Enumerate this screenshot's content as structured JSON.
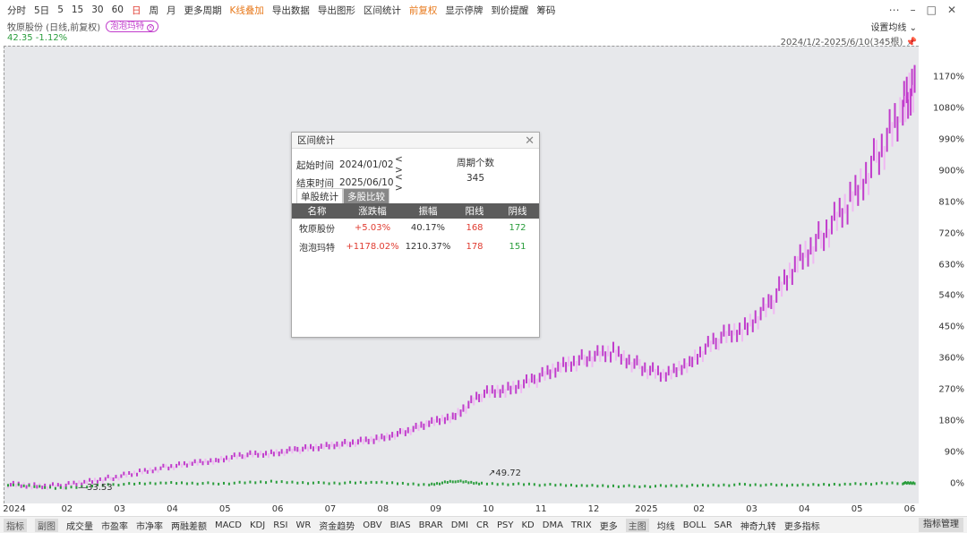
{
  "toolbar": {
    "items": [
      "分时",
      "5日",
      "5",
      "15",
      "30",
      "60",
      "日",
      "周",
      "月",
      "更多周期",
      "K线叠加",
      "导出数据",
      "导出图形",
      "区间统计",
      "前复权",
      "显示停牌",
      "到价提醒",
      "筹码"
    ],
    "active_item": "日",
    "right_icons": [
      "more-icon",
      "minimize-icon",
      "maximize-icon",
      "close-icon"
    ]
  },
  "subhead": {
    "stock_name": "牧原股份 (日线,前复权)",
    "overlay_badge": "泡泡玛特",
    "price_change": "42.35 -1.12%",
    "settings_avg": "设置均线",
    "range_text": "2024/1/2-2025/6/10(345根)"
  },
  "dialog": {
    "title": "区间统计",
    "start_label": "起始时间",
    "start_value": "2024/01/02",
    "end_label": "结束时间",
    "end_value": "2025/06/10",
    "arrows": "< >",
    "period_label": "周期个数",
    "period_value": "345",
    "tab_single": "单股统计",
    "tab_multi": "多股比较",
    "columns": [
      "名称",
      "涨跌幅",
      "振幅",
      "阳线",
      "阴线"
    ],
    "rows": [
      {
        "name": "牧原股份",
        "change": "+5.03%",
        "amplitude": "40.17%",
        "up": "168",
        "down": "172"
      },
      {
        "name": "泡泡玛特",
        "change": "+1178.02%",
        "amplitude": "1210.37%",
        "up": "178",
        "down": "151"
      }
    ]
  },
  "chart_data": {
    "type": "line",
    "y_ticks": [
      "1170%",
      "1080%",
      "990%",
      "900%",
      "810%",
      "720%",
      "630%",
      "540%",
      "450%",
      "360%",
      "270%",
      "180%",
      "90%",
      "0%"
    ],
    "x_ticks": [
      "2024",
      "02",
      "03",
      "04",
      "05",
      "06",
      "07",
      "08",
      "09",
      "10",
      "11",
      "12",
      "2025",
      "02",
      "03",
      "04",
      "05",
      "06"
    ],
    "ylim": [
      -10,
      1230
    ],
    "annotations": [
      "33.53",
      "49.72"
    ],
    "series": [
      {
        "name": "泡泡玛特",
        "color": "#c13ccc",
        "x": [
          0,
          10,
          20,
          30,
          40,
          50,
          60,
          70,
          80,
          90,
          100,
          110,
          120,
          130,
          140,
          150,
          160,
          170,
          180,
          190,
          200,
          210,
          220,
          230,
          240,
          250,
          260,
          270,
          280,
          290,
          300,
          310,
          320,
          330,
          340,
          345
        ],
        "values": [
          0,
          -3,
          -5,
          8,
          20,
          35,
          50,
          60,
          72,
          85,
          90,
          100,
          110,
          120,
          130,
          150,
          175,
          200,
          260,
          275,
          300,
          340,
          365,
          380,
          340,
          310,
          360,
          420,
          450,
          520,
          640,
          720,
          810,
          940,
          1070,
          1178
        ]
      },
      {
        "name": "牧原股份",
        "color": "#2a9d3c",
        "x": [
          0,
          20,
          40,
          60,
          80,
          100,
          120,
          140,
          160,
          170,
          180,
          200,
          220,
          240,
          260,
          280,
          300,
          320,
          340,
          345
        ],
        "values": [
          0,
          -10,
          0,
          5,
          3,
          8,
          4,
          6,
          0,
          10,
          3,
          0,
          -3,
          -5,
          -3,
          0,
          -2,
          2,
          4,
          5
        ]
      }
    ]
  }
}
